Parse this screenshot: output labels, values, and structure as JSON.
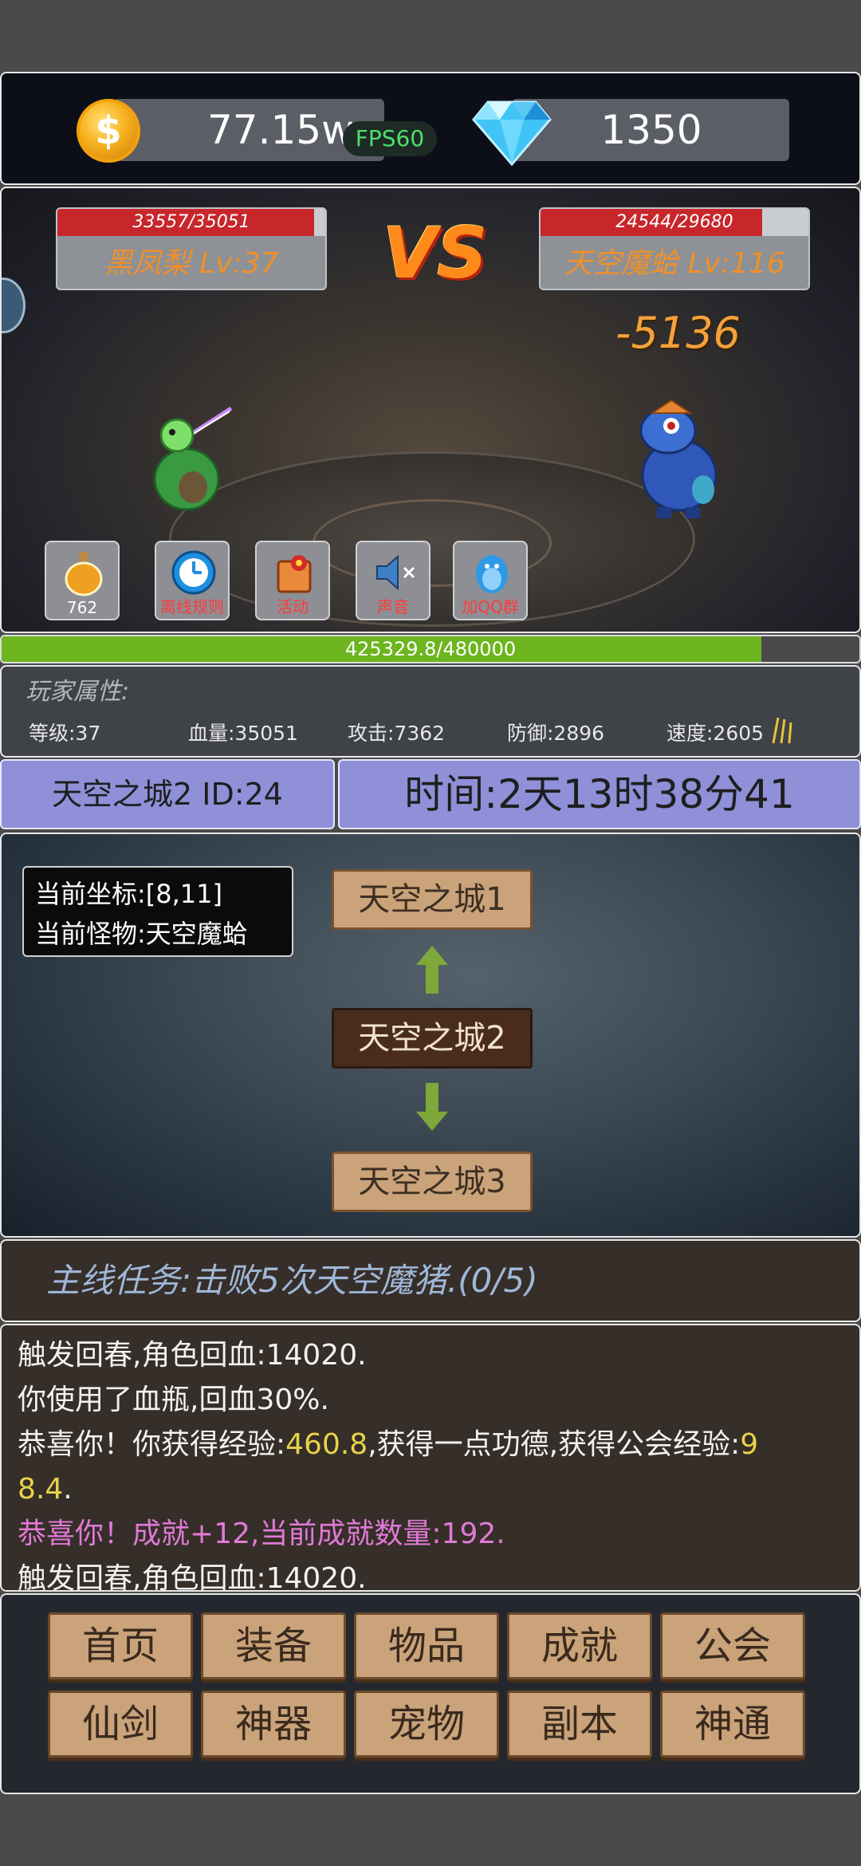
{
  "top_bar": {
    "coin_symbol": "$",
    "gold": "77.15w",
    "fps": "FPS60",
    "diamonds": "1350"
  },
  "battle": {
    "player": {
      "hp_text": "33557/35051",
      "hp_fraction": 0.957,
      "name": "黑凤梨 Lv:37"
    },
    "enemy": {
      "hp_text": "24544/29680",
      "hp_fraction": 0.827,
      "name": "天空魔蛤 Lv:116"
    },
    "vs": "VS",
    "damage": "-5136",
    "quick_buttons": [
      {
        "label": "762",
        "icon": "potion-icon"
      },
      {
        "label": "离线规则",
        "icon": "clock-icon"
      },
      {
        "label": "活动",
        "icon": "gift-icon"
      },
      {
        "label": "声音",
        "icon": "speaker-muted-icon"
      },
      {
        "label": "加QQ群",
        "icon": "qq-penguin-icon"
      }
    ]
  },
  "exp": {
    "text": "425329.8/480000",
    "fraction": 0.886
  },
  "attributes": {
    "title": "玩家属性:",
    "level": "等级:37",
    "hp": "血量:35051",
    "attack": "攻击:7362",
    "defense": "防御:2896",
    "speed": "速度:2605"
  },
  "location": {
    "name": "天空之城2 ID:24",
    "time": "时间:2天13时38分41"
  },
  "map": {
    "coord": "当前坐标:[8,11]",
    "monster": "当前怪物:天空魔蛤",
    "cities": [
      "天空之城1",
      "天空之城2",
      "天空之城3"
    ]
  },
  "quest": {
    "text": "主线任务:击败5次天空魔猪.(0/5)"
  },
  "log": {
    "line1": "触发回春,角色回血:14020.",
    "line2": "你使用了血瓶,回血30%.",
    "line3_a": "恭喜你！你获得经验:",
    "line3_b": "460.8",
    "line3_c": ",获得一点功德,获得公会经验:",
    "line3_d": "9",
    "line4_a": "8.4",
    "line4_b": ".",
    "line5": "恭喜你！成就+12,当前成就数量:192.",
    "line6": "触发回春,角色回血:14020."
  },
  "menu": {
    "row1": [
      "首页",
      "装备",
      "物品",
      "成就",
      "公会"
    ],
    "row2": [
      "仙剑",
      "神器",
      "宠物",
      "副本",
      "神通"
    ]
  },
  "colors": {
    "hp_red": "#c7262b",
    "exp_green": "#6db51f",
    "location_purple": "#8f90d8",
    "wood": "#caa37a",
    "gold_text": "#e8d34a",
    "pink_text": "#e07ad6"
  }
}
